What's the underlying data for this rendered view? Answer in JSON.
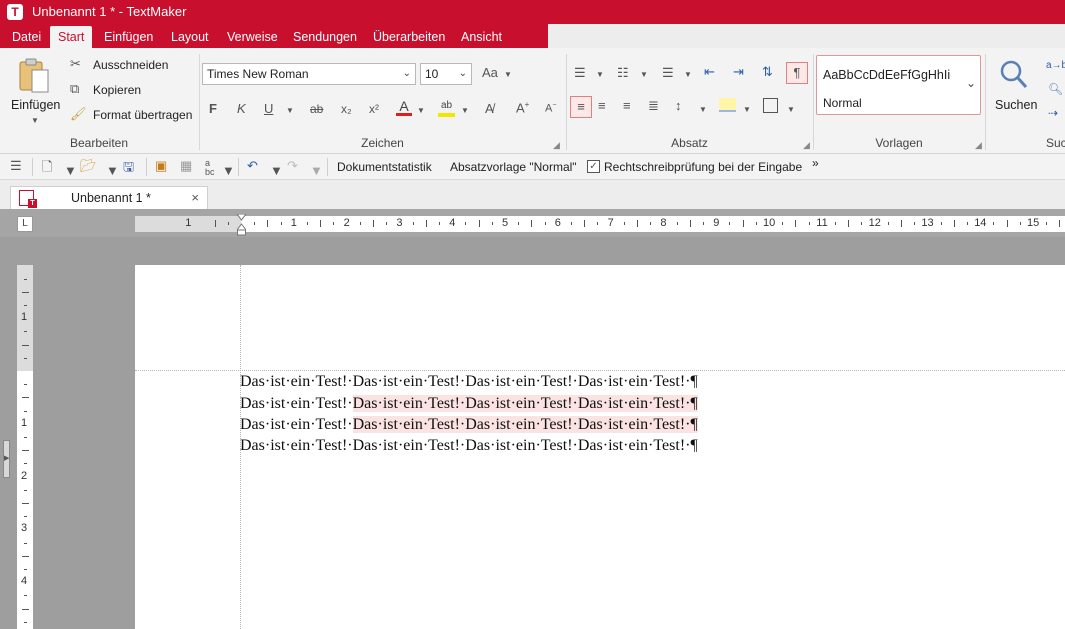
{
  "window": {
    "title": "Unbenannt 1 * - TextMaker",
    "logo_letter": "T"
  },
  "menu": {
    "tabs": [
      "Datei",
      "Start",
      "Einfügen",
      "Layout",
      "Verweise",
      "Sendungen",
      "Überarbeiten",
      "Ansicht"
    ],
    "active": "Start"
  },
  "ribbon": {
    "bearbeiten": {
      "paste_label": "Einfügen",
      "cut_label": "Ausschneiden",
      "copy_label": "Kopieren",
      "format_painter_label": "Format übertragen",
      "group_label": "Bearbeiten"
    },
    "zeichen": {
      "font_name": "Times New Roman",
      "font_size": "10",
      "bold_label": "F",
      "italic_label": "K",
      "underline_label": "U",
      "strike_label": "ab",
      "sub_label": "x₂",
      "sup_label": "x²",
      "font_color_label": "A",
      "highlight_label": "ab",
      "group_label": "Zeichen"
    },
    "absatz": {
      "group_label": "Absatz",
      "pilcrow": "¶"
    },
    "vorlagen": {
      "preview_text": "AaBbCcDdEeFfGgHhIi",
      "style_name": "Normal",
      "group_label": "Vorlagen"
    },
    "suchen": {
      "search_label": "Suchen",
      "group_label": "Suc",
      "replace_hint": "a→b"
    }
  },
  "quickbar": {
    "stats_label": "Dokumentstatistik",
    "style_label": "Absatzvorlage \"Normal\"",
    "spellcheck_label": "Rechtschreibprüfung bei der Eingabe",
    "spellcheck_checked": true,
    "more": "»"
  },
  "doc_tab": {
    "title": "Unbenannt 1 *",
    "close": "×"
  },
  "ruler": {
    "h_numbers": [
      "1",
      "1",
      "2",
      "3",
      "4",
      "5",
      "6",
      "7",
      "8",
      "9",
      "10",
      "11",
      "12",
      "13",
      "14",
      "15"
    ],
    "v_numbers": [
      "1",
      "1",
      "2",
      "3",
      "4"
    ],
    "corner_symbol": "L"
  },
  "document": {
    "lines": [
      "Das·ist·ein·Test!·Das·ist·ein·Test!·Das·ist·ein·Test!·Das·ist·ein·Test!·¶",
      "Das·ist·ein·Test!·Das·ist·ein·Test!·Das·ist·ein·Test!·Das·ist·ein·Test!·¶",
      "Das·ist·ein·Test!·Das·ist·ein·Test!·Das·ist·ein·Test!·Das·ist·ein·Test!·¶",
      "Das·ist·ein·Test!·Das·ist·ein·Test!·Das·ist·ein·Test!·Das·ist·ein·Test!·¶"
    ],
    "line2_a": "Das·ist·ein·Test!·",
    "line2_b": "Das·ist·ein·Test!·Das·ist·ein·Test!·Das·ist·ein·Test!·¶",
    "line3_a": "Das·ist·ein·Test!·",
    "line3_b": "Das·ist·ein·Test!·Das·ist·ein·Test!·Das·ist·ein·Test!·¶",
    "highlight_color": "#fbe3e3"
  },
  "colors": {
    "accent": "#c8102e",
    "ribbon_bg": "#f3f3f3",
    "workspace_bg": "#9e9e9e"
  }
}
